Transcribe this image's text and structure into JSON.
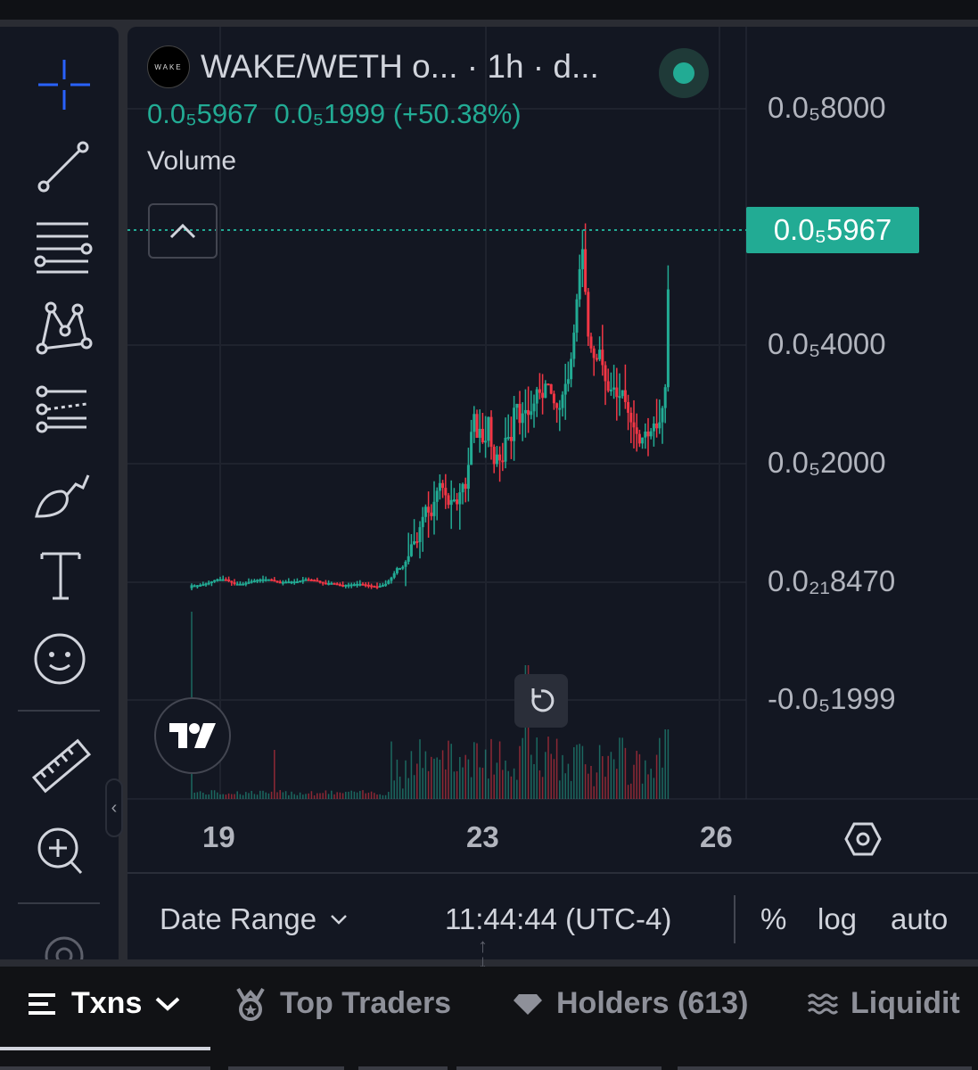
{
  "window": {
    "pair_title": "WAKE/WETH o...",
    "interval_sep": " · 1h · d...",
    "logo_text": "WAKE"
  },
  "legend": {
    "close": "0.0₅5967",
    "change": "0.0₅1999 (+50.38%)",
    "volume_label": "Volume"
  },
  "price_axis": {
    "labels": [
      "0.0₅8000",
      "0.0₅4000",
      "0.0₅2000",
      "0.0₂₁8470",
      "-0.0₅1999"
    ],
    "last_price": "0.0₅5967"
  },
  "time_axis": {
    "labels": [
      "19",
      "23",
      "26"
    ]
  },
  "bottom_bar": {
    "date_range": "Date Range",
    "clock": "11:44:44 (UTC-4)",
    "percent": "%",
    "log": "log",
    "auto": "auto"
  },
  "tabs": {
    "txns": "Txns",
    "top_traders": "Top Traders",
    "holders": "Holders (613)",
    "liquidity": "Liquidit"
  },
  "colors": {
    "up": "#22ab94",
    "down": "#f23645",
    "accent_blue": "#2962ff"
  },
  "chart_data": {
    "type": "candlestick",
    "title": "WAKE/WETH o... · 1h · d...",
    "y_ticks": [
      "0.0₅8000",
      "0.0₅4000",
      "0.0₅2000",
      "0.0₂₁8470",
      "-0.0₅1999"
    ],
    "x_ticks": [
      "19",
      "23",
      "26"
    ],
    "y_values_unit": "×1e-6 (rescaled percentage axis, approximate)",
    "trend_points": [
      [
        0,
        1.18
      ],
      [
        2,
        1.22
      ],
      [
        10,
        1.22
      ],
      [
        20,
        1.25
      ],
      [
        30,
        1.3
      ],
      [
        40,
        1.3
      ],
      [
        50,
        1.24
      ],
      [
        60,
        1.24
      ],
      [
        70,
        1.28
      ],
      [
        80,
        1.3
      ],
      [
        90,
        1.3
      ],
      [
        100,
        1.26
      ],
      [
        110,
        1.27
      ],
      [
        120,
        1.27
      ],
      [
        130,
        1.3
      ],
      [
        140,
        1.29
      ],
      [
        150,
        1.25
      ],
      [
        160,
        1.25
      ],
      [
        170,
        1.22
      ],
      [
        180,
        1.23
      ],
      [
        190,
        1.24
      ],
      [
        200,
        1.22
      ],
      [
        210,
        1.2
      ],
      [
        220,
        1.24
      ],
      [
        228,
        1.35
      ],
      [
        232,
        1.45
      ],
      [
        238,
        1.45
      ],
      [
        245,
        1.6
      ],
      [
        250,
        1.85
      ],
      [
        254,
        1.75
      ],
      [
        258,
        2.0
      ],
      [
        265,
        2.3
      ],
      [
        270,
        2.1
      ],
      [
        275,
        2.4
      ],
      [
        280,
        2.6
      ],
      [
        285,
        2.5
      ],
      [
        290,
        2.3
      ],
      [
        295,
        2.4
      ],
      [
        300,
        2.3
      ],
      [
        305,
        2.6
      ],
      [
        310,
        2.5
      ],
      [
        315,
        3.2
      ],
      [
        318,
        3.6
      ],
      [
        322,
        3.2
      ],
      [
        326,
        3.35
      ],
      [
        330,
        3.0
      ],
      [
        335,
        3.5
      ],
      [
        340,
        2.8
      ],
      [
        345,
        3.0
      ],
      [
        350,
        2.8
      ],
      [
        355,
        3.3
      ],
      [
        360,
        3.1
      ],
      [
        365,
        3.8
      ],
      [
        370,
        3.4
      ],
      [
        375,
        3.6
      ],
      [
        380,
        3.5
      ],
      [
        385,
        3.6
      ],
      [
        390,
        3.9
      ],
      [
        395,
        3.7
      ],
      [
        400,
        4.0
      ],
      [
        405,
        3.8
      ],
      [
        410,
        3.6
      ],
      [
        415,
        3.6
      ],
      [
        420,
        3.9
      ],
      [
        425,
        4.0
      ],
      [
        430,
        4.5
      ],
      [
        435,
        5.2
      ],
      [
        440,
        5.8
      ],
      [
        443,
        5.3
      ],
      [
        446,
        4.6
      ],
      [
        450,
        4.4
      ],
      [
        455,
        4.2
      ],
      [
        460,
        4.4
      ],
      [
        465,
        4.0
      ],
      [
        470,
        3.8
      ],
      [
        475,
        3.9
      ],
      [
        480,
        3.7
      ],
      [
        485,
        3.85
      ],
      [
        490,
        3.6
      ],
      [
        495,
        3.4
      ],
      [
        500,
        3.3
      ],
      [
        505,
        3.1
      ],
      [
        510,
        3.3
      ],
      [
        515,
        3.2
      ],
      [
        520,
        3.4
      ],
      [
        525,
        3.3
      ],
      [
        530,
        3.6
      ],
      [
        533,
        3.8
      ],
      [
        536,
        5.0
      ],
      [
        538,
        5.967
      ]
    ]
  }
}
